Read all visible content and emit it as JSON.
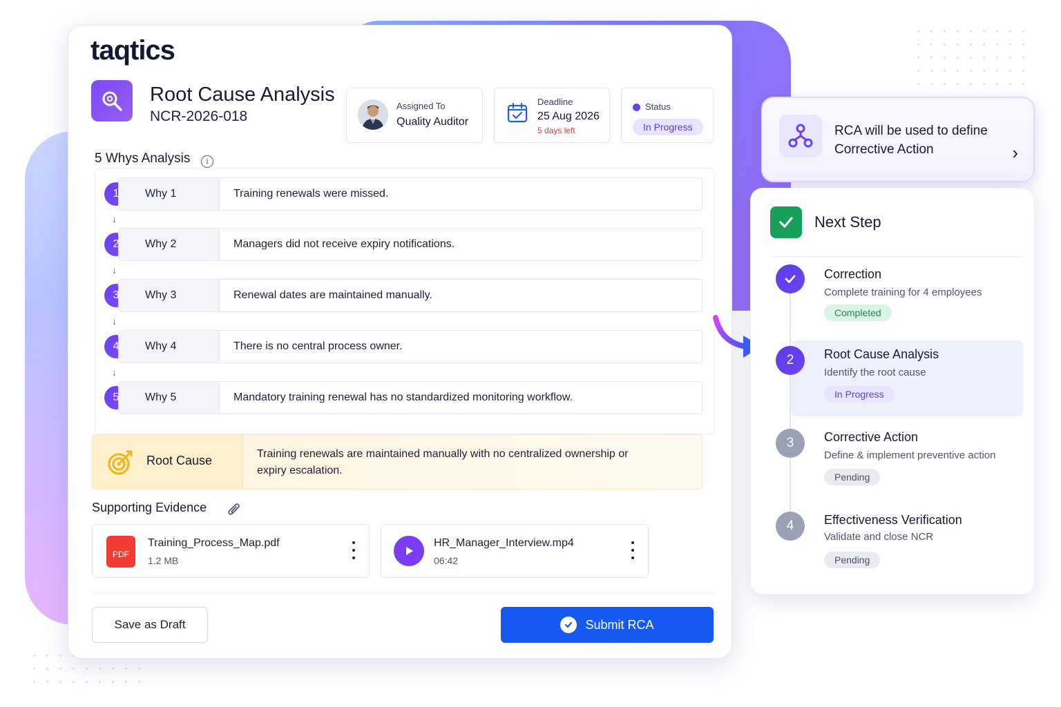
{
  "brand": {
    "logo": "taqtics"
  },
  "header": {
    "title": "Root Cause Analysis",
    "ncr_id": "NCR-2026-018",
    "assigned": {
      "label": "Assigned To",
      "value": "Quality Auditor"
    },
    "deadline": {
      "label": "Deadline",
      "value": "25 Aug 2026",
      "remaining": "5 days left"
    },
    "status": {
      "label": "Status",
      "value": "In Progress"
    }
  },
  "whys": {
    "title": "5 Whys Analysis",
    "items": [
      {
        "num": "1",
        "label": "Why 1",
        "text": "Training renewals were missed."
      },
      {
        "num": "2",
        "label": "Why 2",
        "text": "Managers did not receive expiry notifications."
      },
      {
        "num": "3",
        "label": "Why 3",
        "text": "Renewal dates are maintained manually."
      },
      {
        "num": "4",
        "label": "Why 4",
        "text": "There is no central process owner."
      },
      {
        "num": "5",
        "label": "Why 5",
        "text": "Mandatory training renewal has no standardized monitoring workflow."
      }
    ]
  },
  "root_cause": {
    "label": "Root Cause",
    "text": "Training renewals are maintained manually with no centralized ownership or expiry escalation."
  },
  "evidence": {
    "title": "Supporting Evidence",
    "files": [
      {
        "name": "Training_Process_Map.pdf",
        "meta": "1.2 MB",
        "type_label": "PDF"
      },
      {
        "name": "HR_Manager_Interview.mp4",
        "meta": "06:42"
      }
    ]
  },
  "actions": {
    "draft": "Save as Draft",
    "submit": "Submit RCA"
  },
  "rca_banner": {
    "line1": "RCA will be used to define",
    "line2": "Corrective Action"
  },
  "next_step": {
    "title": "Next Step",
    "steps": [
      {
        "num": "",
        "title": "Correction",
        "desc": "Complete training for 4 employees",
        "status": "Completed"
      },
      {
        "num": "2",
        "title": "Root Cause Analysis",
        "desc": "Identify the root cause",
        "status": "In Progress"
      },
      {
        "num": "3",
        "title": "Corrective Action",
        "desc": "Define & implement preventive action",
        "status": "Pending"
      },
      {
        "num": "4",
        "title": "Effectiveness Verification",
        "desc": "Validate and close NCR",
        "status": "Pending"
      }
    ]
  },
  "colors": {
    "accent": "#6a40f3",
    "primary_button": "#1559f0",
    "success": "#16a05a",
    "deadline_warning": "#e23a3a",
    "root_cause_bg": "#fff3d9"
  },
  "icons": {
    "header": "search-analysis-icon",
    "deadline": "calendar-icon",
    "info": "info-icon",
    "root_cause": "target-icon",
    "evidence": "paperclip-icon",
    "pdf": "pdf-file-icon",
    "video": "play-icon",
    "submit": "check-circle-icon",
    "rca_banner": "workflow-icon",
    "next_step": "checkbox-icon"
  }
}
